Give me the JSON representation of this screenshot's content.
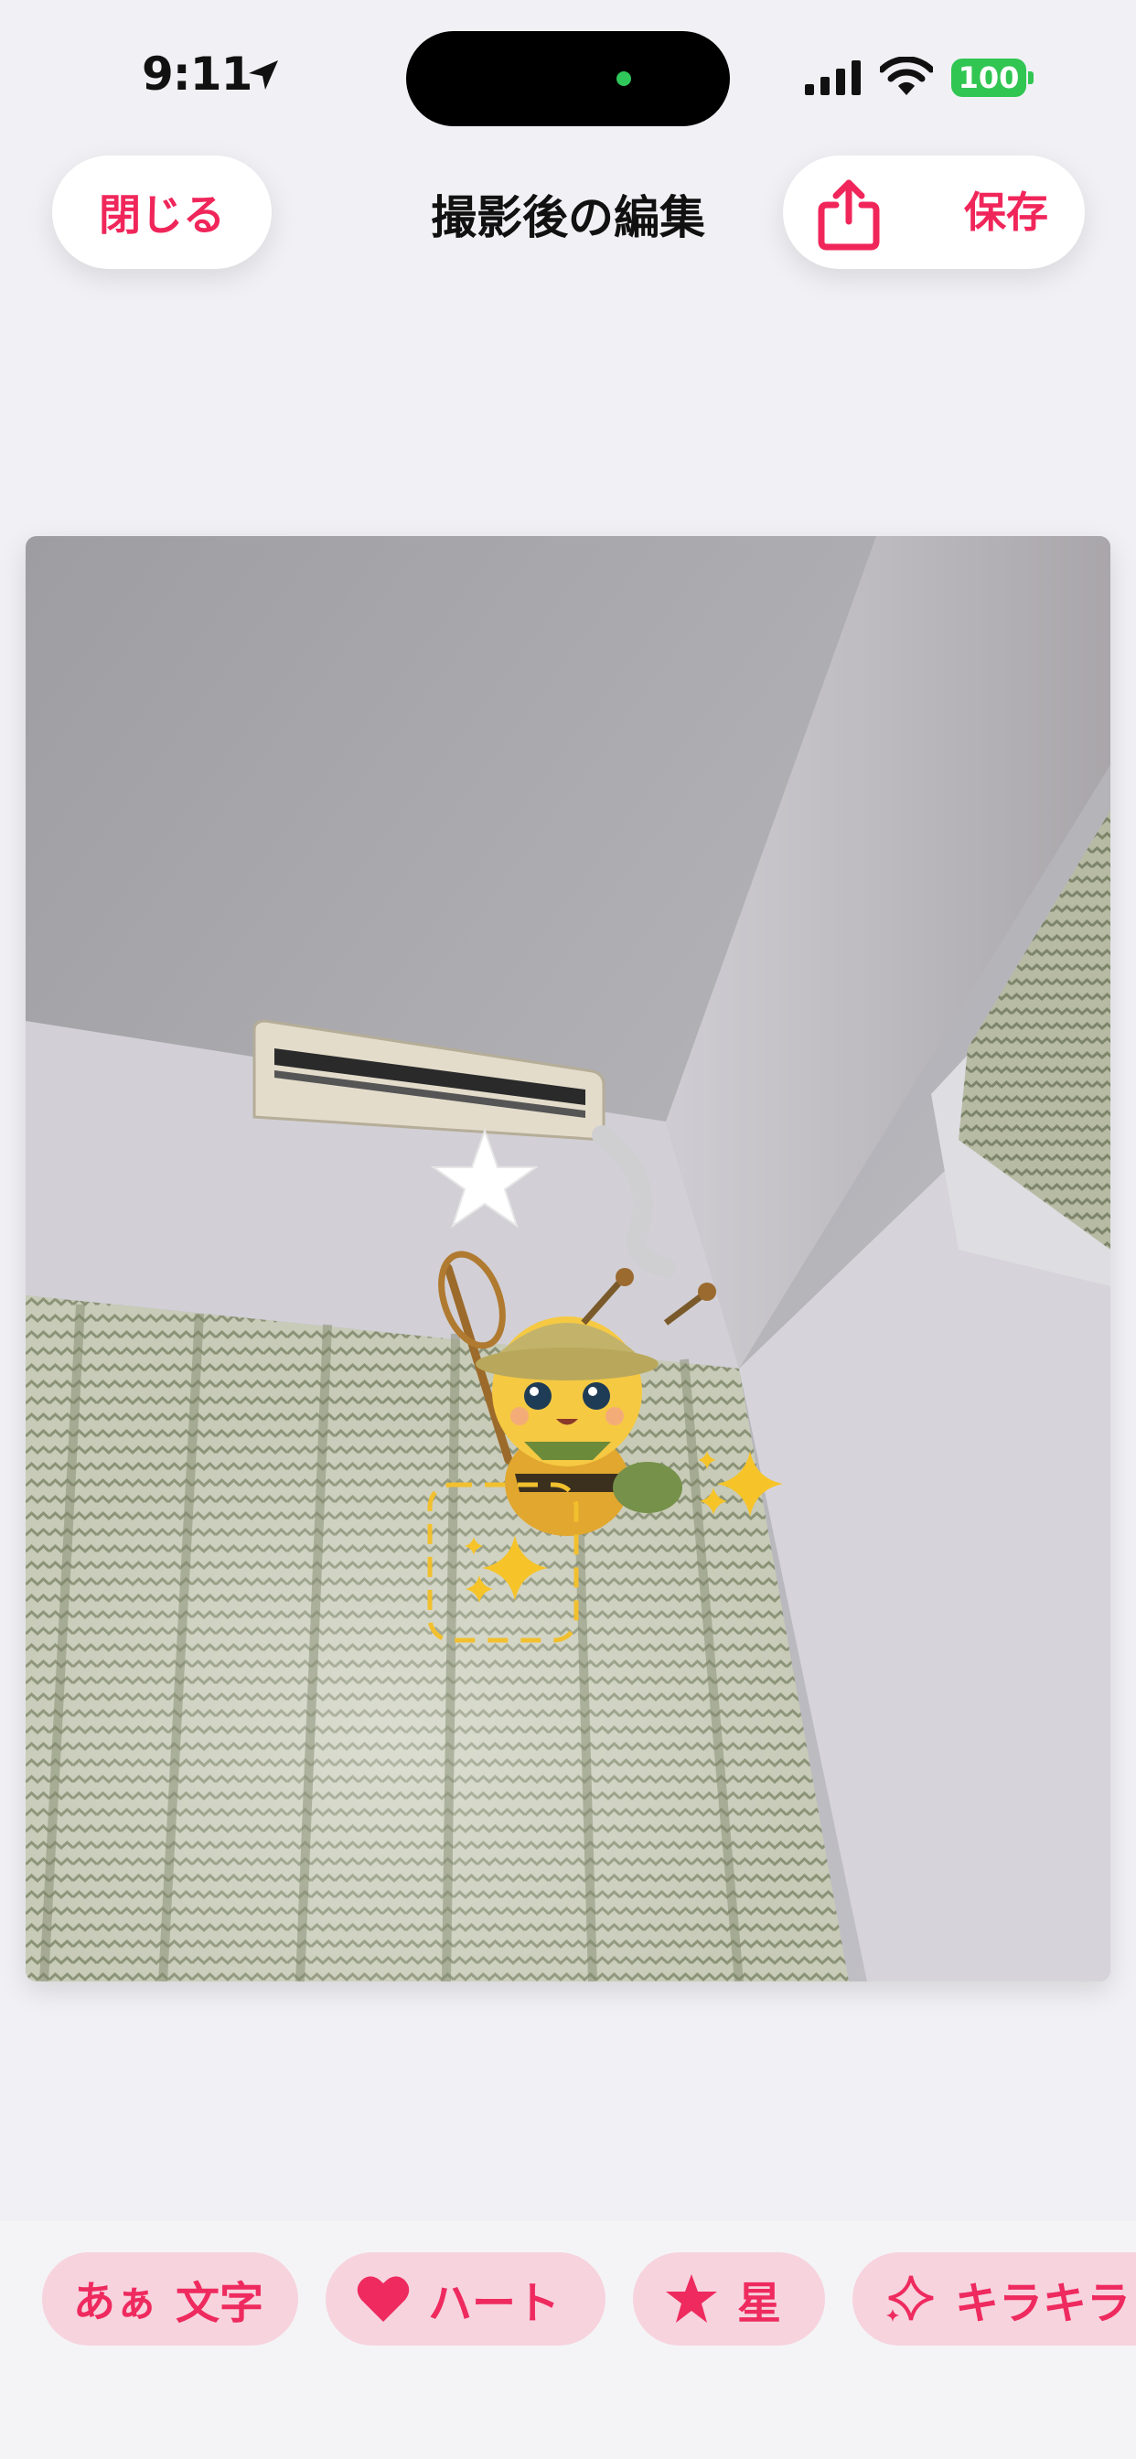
{
  "status_bar": {
    "time": "9:11",
    "battery": "100"
  },
  "header": {
    "close_label": "閉じる",
    "title": "撮影後の編集",
    "save_label": "保存"
  },
  "photo": {
    "stickers": [
      "star",
      "bee-character",
      "sparkle",
      "sparkle-selected"
    ]
  },
  "toolbar": {
    "items": [
      {
        "icon_text": "あぁ",
        "label": "文字"
      },
      {
        "icon": "heart-icon",
        "label": "ハート"
      },
      {
        "icon": "star-icon",
        "label": "星"
      },
      {
        "icon": "sparkle-icon",
        "label": "キラキラ"
      }
    ]
  },
  "colors": {
    "accent": "#f0265a",
    "pill_bg": "#f7d3de",
    "sticker_yellow": "#f6c428"
  }
}
